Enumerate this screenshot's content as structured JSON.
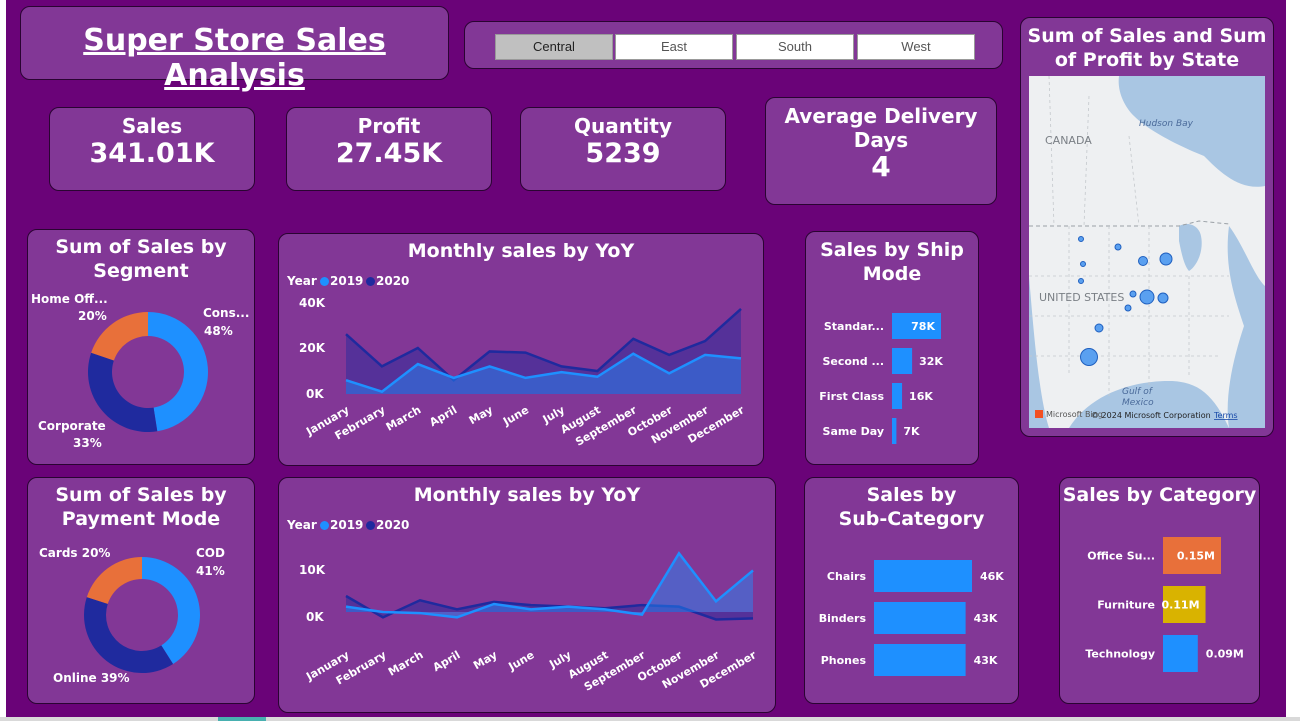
{
  "header": {
    "title": "Super Store Sales Analysis"
  },
  "slicer": {
    "options": [
      "Central",
      "East",
      "South",
      "West"
    ],
    "selected": "Central"
  },
  "kpis": {
    "sales": {
      "label": "Sales",
      "value": "341.01K"
    },
    "profit": {
      "label": "Profit",
      "value": "27.45K"
    },
    "quantity": {
      "label": "Quantity",
      "value": "5239"
    },
    "delivery": {
      "label_line1": "Average Delivery",
      "label_line2": "Days",
      "value": "4"
    }
  },
  "map": {
    "title_line1": "Sum of Sales and Sum",
    "title_line2": "of Profit by State",
    "labels": {
      "canada": "CANADA",
      "hudson": "Hudson Bay",
      "us": "UNITED STATES",
      "gulf1": "Gulf of",
      "gulf2": "Mexico"
    },
    "copyright": "© 2024 Microsoft Corporation",
    "brand": "Microsoft Bing",
    "terms": "Terms"
  },
  "segment": {
    "title_line1": "Sum of Sales by",
    "title_line2": "Segment",
    "labels": [
      {
        "name": "Home Off...",
        "pct": "20%"
      },
      {
        "name": "Cons...",
        "pct": "48%"
      },
      {
        "name": "Corporate",
        "pct": "33%"
      }
    ]
  },
  "payment": {
    "title_line1": "Sum of Sales by",
    "title_line2": "Payment Mode",
    "labels": [
      {
        "text": "Cards 20%"
      },
      {
        "name": "COD",
        "pct": "41%"
      },
      {
        "text": "Online 39%"
      }
    ]
  },
  "yoy1": {
    "title": "Monthly sales by YoY",
    "legend_title": "Year",
    "legend": [
      "2019",
      "2020"
    ],
    "yticks": [
      "40K",
      "20K",
      "0K"
    ]
  },
  "yoy2": {
    "title": "Monthly sales by YoY",
    "legend_title": "Year",
    "legend": [
      "2019",
      "2020"
    ],
    "yticks": [
      "10K",
      "0K"
    ]
  },
  "ship": {
    "title_line1": "Sales by Ship",
    "title_line2": "Mode",
    "rows": [
      {
        "label": "Standar...",
        "value": "78K"
      },
      {
        "label": "Second ...",
        "value": "32K"
      },
      {
        "label": "First Class",
        "value": "16K"
      },
      {
        "label": "Same Day",
        "value": "7K"
      }
    ]
  },
  "subcat": {
    "title_line1": "Sales by",
    "title_line2": "Sub-Category",
    "rows": [
      {
        "label": "Chairs",
        "value": "46K"
      },
      {
        "label": "Binders",
        "value": "43K"
      },
      {
        "label": "Phones",
        "value": "43K"
      }
    ]
  },
  "category": {
    "title": "Sales by Category",
    "rows": [
      {
        "label": "Office Su...",
        "value": "0.15M"
      },
      {
        "label": "Furniture",
        "value": "0.11M"
      },
      {
        "label": "Technology",
        "value": "0.09M"
      }
    ]
  },
  "colors": {
    "background": "#6a0378",
    "card": "#823796",
    "series_2019": "#1e90ff",
    "series_2020": "#1f2a9e",
    "orange": "#e8703a",
    "gold": "#d9b300"
  },
  "chart_data": [
    {
      "type": "area",
      "title": "Monthly sales by YoY",
      "categories": [
        "January",
        "February",
        "March",
        "April",
        "May",
        "June",
        "July",
        "August",
        "September",
        "October",
        "November",
        "December"
      ],
      "series": [
        {
          "name": "2019",
          "values": [
            6000,
            1000,
            13000,
            7000,
            12000,
            7000,
            9500,
            7500,
            17500,
            9000,
            17000,
            15500
          ]
        },
        {
          "name": "2020",
          "values": [
            26000,
            12000,
            20000,
            6000,
            18500,
            18000,
            12000,
            10000,
            24000,
            17000,
            23000,
            37000
          ]
        }
      ],
      "ylim": [
        0,
        40000
      ],
      "yticks": [
        0,
        20000,
        40000
      ],
      "legend": "top-left"
    },
    {
      "type": "area",
      "title": "Monthly sales by YoY",
      "categories": [
        "January",
        "February",
        "March",
        "April",
        "May",
        "June",
        "July",
        "August",
        "September",
        "October",
        "November",
        "December"
      ],
      "series": [
        {
          "name": "2019",
          "values": [
            1000,
            0,
            -200,
            -1000,
            1500,
            500,
            1000,
            500,
            -500,
            11000,
            2000,
            7800
          ]
        },
        {
          "name": "2020",
          "values": [
            3000,
            -1000,
            2200,
            500,
            1900,
            1300,
            1000,
            700,
            1300,
            1000,
            -1400,
            -1200
          ]
        }
      ],
      "ylim": [
        -3000,
        12000
      ],
      "yticks": [
        0,
        10000
      ],
      "legend": "top-left"
    },
    {
      "type": "pie",
      "title": "Sum of Sales by Segment",
      "categories": [
        "Consumer",
        "Corporate",
        "Home Office"
      ],
      "values": [
        48,
        33,
        20
      ]
    },
    {
      "type": "pie",
      "title": "Sum of Sales by Payment Mode",
      "categories": [
        "COD",
        "Online",
        "Cards"
      ],
      "values": [
        41,
        39,
        20
      ]
    },
    {
      "type": "bar",
      "title": "Sales by Ship Mode",
      "categories": [
        "Standar...",
        "Second ...",
        "First Class",
        "Same Day"
      ],
      "values": [
        78,
        32,
        16,
        7
      ]
    },
    {
      "type": "bar",
      "title": "Sales by Sub-Category",
      "categories": [
        "Chairs",
        "Binders",
        "Phones"
      ],
      "values": [
        46,
        43,
        43
      ]
    },
    {
      "type": "bar",
      "title": "Sales by Category",
      "categories": [
        "Office Su...",
        "Furniture",
        "Technology"
      ],
      "values": [
        0.15,
        0.11,
        0.09
      ]
    }
  ]
}
